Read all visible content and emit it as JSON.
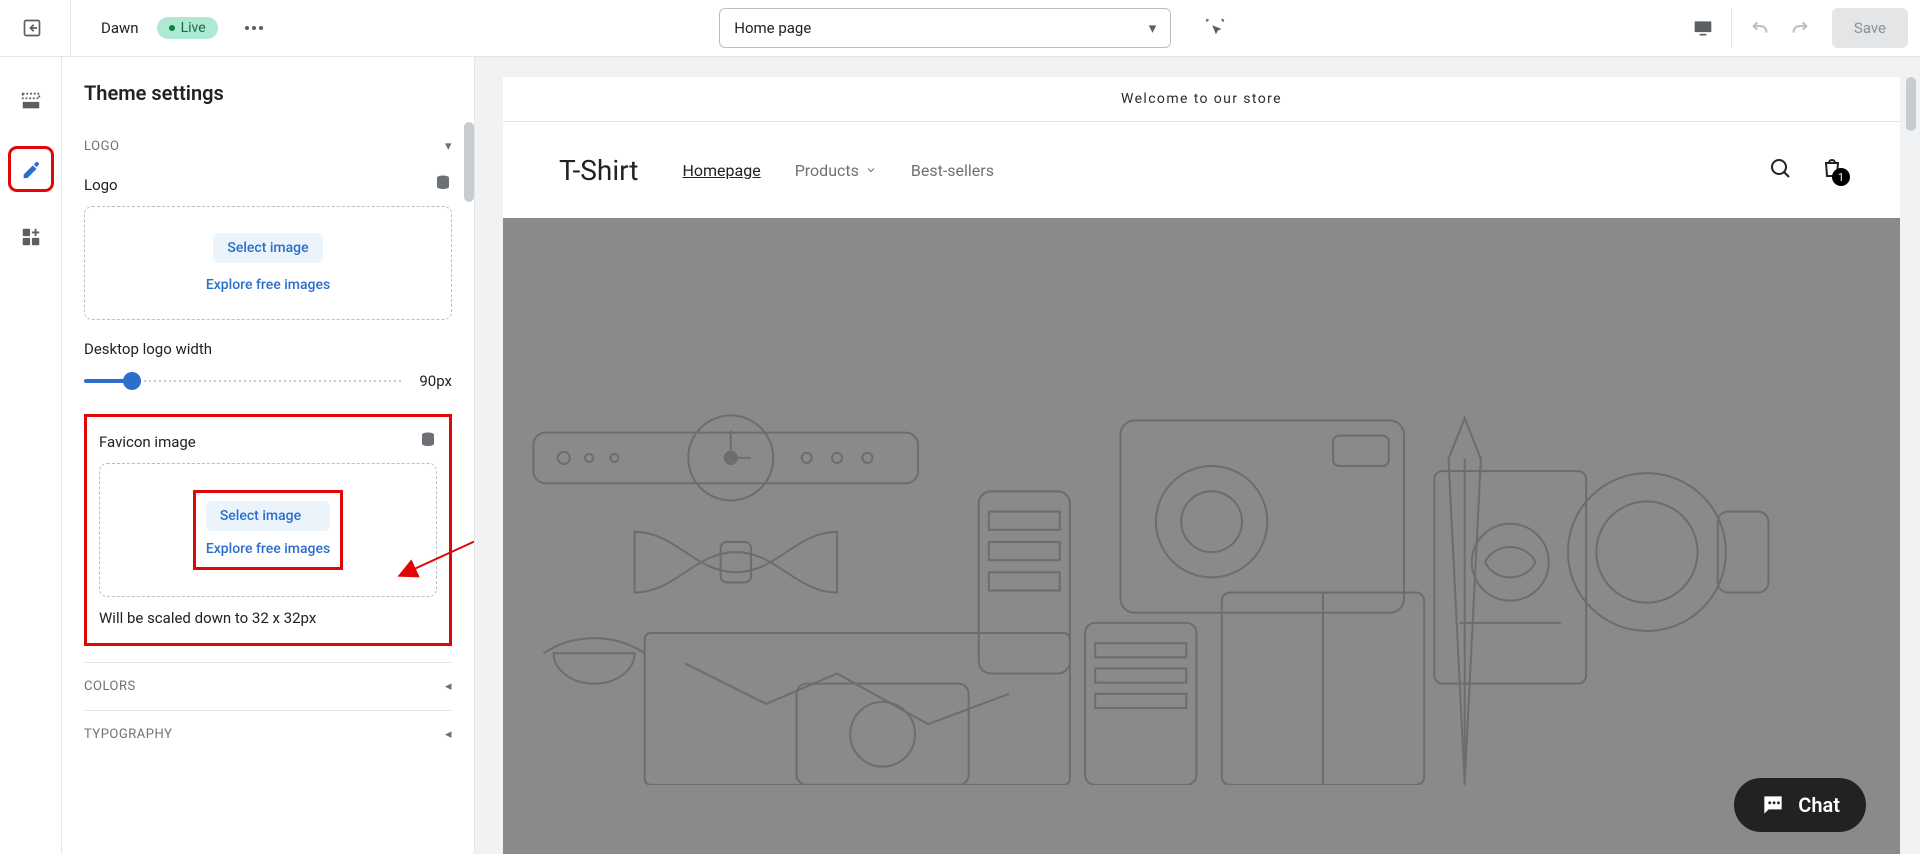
{
  "topbar": {
    "theme_name": "Dawn",
    "status_label": "Live",
    "page_select_value": "Home page",
    "save_label": "Save"
  },
  "panel": {
    "title": "Theme settings",
    "sections": {
      "logo": {
        "heading": "LOGO",
        "label": "Logo",
        "select_btn": "Select image",
        "explore_link": "Explore free images",
        "slider_label": "Desktop logo width",
        "slider_value": "90px",
        "slider_percent": 15
      },
      "favicon": {
        "label": "Favicon image",
        "select_btn": "Select image",
        "explore_link": "Explore free images",
        "hint": "Will be scaled down to 32 x 32px"
      },
      "colors_heading": "COLORS",
      "typography_heading": "TYPOGRAPHY"
    }
  },
  "preview": {
    "announcement": "Welcome to our store",
    "brand": "T-Shirt",
    "nav": {
      "home": "Homepage",
      "products": "Products",
      "bestsellers": "Best-sellers"
    },
    "cart_count": "1",
    "chat_label": "Chat"
  },
  "colors": {
    "accent": "#2c6ecb",
    "highlight_red": "#e20707",
    "live_bg": "#aee9d1"
  }
}
